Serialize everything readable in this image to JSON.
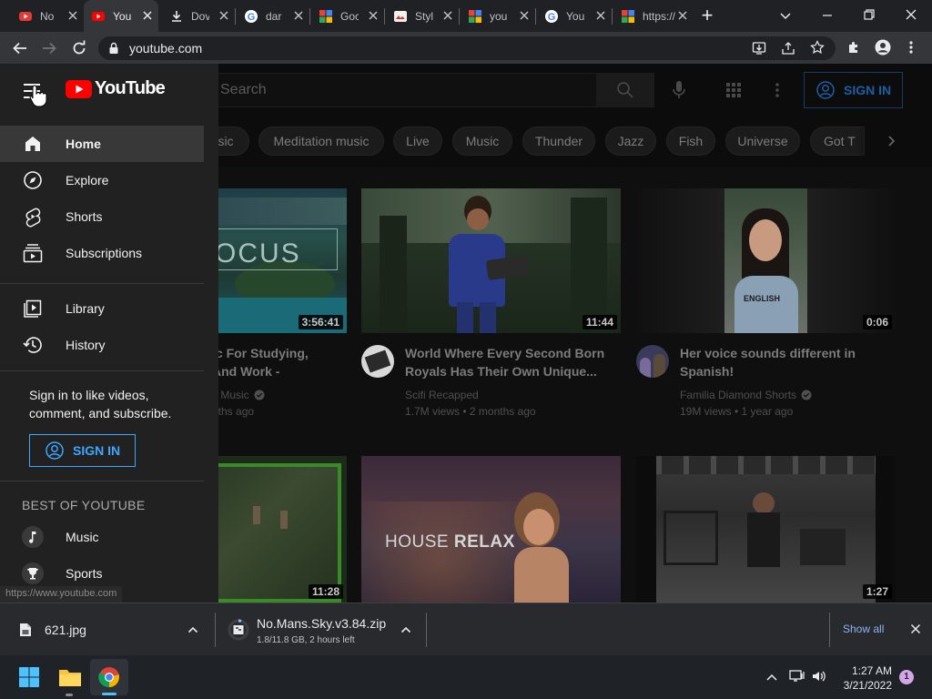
{
  "browser": {
    "tabs": [
      {
        "title": "No"
      },
      {
        "title": "You"
      },
      {
        "title": "Dov"
      },
      {
        "title": "dar"
      },
      {
        "title": "Goc"
      },
      {
        "title": "Styl"
      },
      {
        "title": "you"
      },
      {
        "title": "You"
      },
      {
        "title": "https://"
      }
    ],
    "new_tab_label": "+",
    "address": "youtube.com",
    "status_url": "https://www.youtube.com"
  },
  "youtube": {
    "logo_text": "YouTube",
    "search_placeholder": "Search",
    "signin_label": "SIGN IN",
    "chips": [
      "sic",
      "Meditation music",
      "Live",
      "Music",
      "Thunder",
      "Jazz",
      "Fish",
      "Universe",
      "Got T"
    ],
    "sidebar": {
      "primary": [
        {
          "label": "Home",
          "icon": "home-icon"
        },
        {
          "label": "Explore",
          "icon": "compass-icon"
        },
        {
          "label": "Shorts",
          "icon": "shorts-icon"
        },
        {
          "label": "Subscriptions",
          "icon": "subscriptions-icon"
        }
      ],
      "secondary": [
        {
          "label": "Library",
          "icon": "library-icon"
        },
        {
          "label": "History",
          "icon": "history-icon"
        }
      ],
      "signin_prompt": "Sign in to like videos, comment, and subscribe.",
      "signin_label": "SIGN IN",
      "best_heading": "BEST OF YOUTUBE",
      "best": [
        {
          "label": "Music",
          "icon": "music-note-icon"
        },
        {
          "label": "Sports",
          "icon": "trophy-icon"
        }
      ]
    },
    "videos": [
      {
        "title_line1": "ic For Studying,",
        "title_line2": "And Work -",
        "channel": "y Music",
        "meta": "nths ago",
        "duration": "3:56:41",
        "thumb_text": "OCUS"
      },
      {
        "title_line1": "World Where Every Second Born",
        "title_line2": "Royals Has Their Own Unique...",
        "channel": "Scifi Recapped",
        "meta": "1.7M views • 2 months ago",
        "duration": "11:44"
      },
      {
        "title_line1": "Her voice sounds different in",
        "title_line2": "Spanish!",
        "channel": "Familia Diamond Shorts",
        "meta": "19M views • 1 year ago",
        "duration": "0:06",
        "thumb_text": "ENGLISH"
      },
      {
        "duration": "11:28"
      },
      {
        "duration": "",
        "thumb_text_a": "HOUSE ",
        "thumb_text_b": "RELAX"
      },
      {
        "duration": "1:27"
      }
    ]
  },
  "downloads": {
    "items": [
      {
        "name": "621.jpg",
        "status": ""
      },
      {
        "name": "No.Mans.Sky.v3.84.zip",
        "status": "1.8/11.8 GB, 2 hours left"
      }
    ],
    "show_all": "Show all"
  },
  "taskbar": {
    "time": "1:27 AM",
    "date": "3/21/2022",
    "notification_count": "1"
  }
}
